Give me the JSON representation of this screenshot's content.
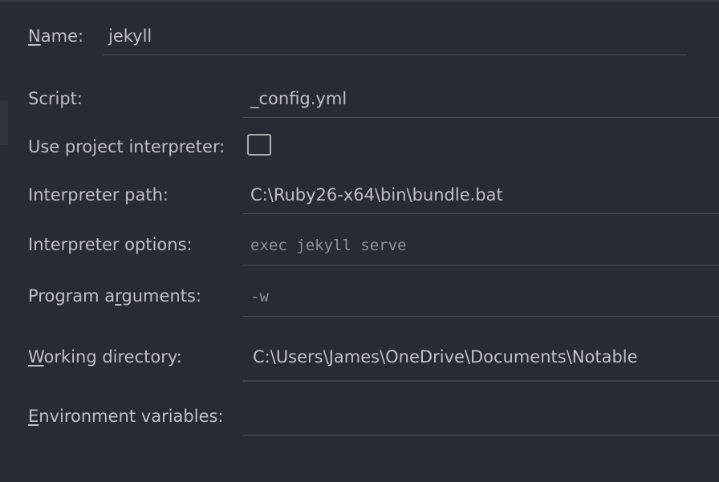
{
  "form": {
    "name": {
      "label_prefix": "",
      "label_mnemonic": "N",
      "label_suffix": "ame:",
      "value": "jekyll"
    },
    "script": {
      "label": "Script:",
      "value": "_config.yml"
    },
    "use_project_interpreter": {
      "label": "Use project interpreter:",
      "checked": false
    },
    "interpreter_path": {
      "label": "Interpreter path:",
      "value": "C:\\Ruby26-x64\\bin\\bundle.bat"
    },
    "interpreter_options": {
      "label": "Interpreter options:",
      "value": "exec jekyll serve"
    },
    "program_arguments": {
      "label_prefix": "Program a",
      "label_mnemonic": "r",
      "label_suffix": "guments:",
      "value": "-w"
    },
    "working_directory": {
      "label_prefix": "",
      "label_mnemonic": "W",
      "label_suffix": "orking directory:",
      "value": "C:\\Users\\James\\OneDrive\\Documents\\Notable"
    },
    "environment_variables": {
      "label_prefix": "",
      "label_mnemonic": "E",
      "label_suffix": "nvironment variables:",
      "value": ""
    }
  }
}
